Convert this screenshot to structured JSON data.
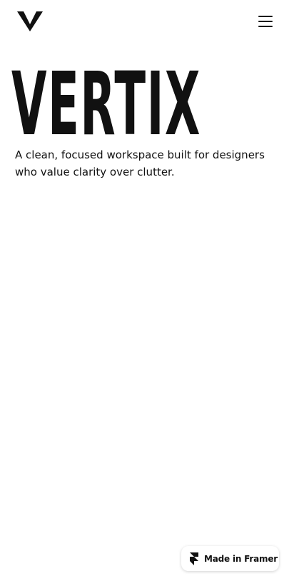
{
  "header": {
    "logo_icon": "vertix-v-logo-icon",
    "menu_icon": "hamburger-menu-icon"
  },
  "hero": {
    "title": "VERTIX",
    "subtitle": "A clean, focused workspace built for designers who value clarity over clutter."
  },
  "badge": {
    "icon": "framer-logo-icon",
    "label": "Made in Framer"
  },
  "colors": {
    "background": "#ffffff",
    "text": "#111111"
  }
}
